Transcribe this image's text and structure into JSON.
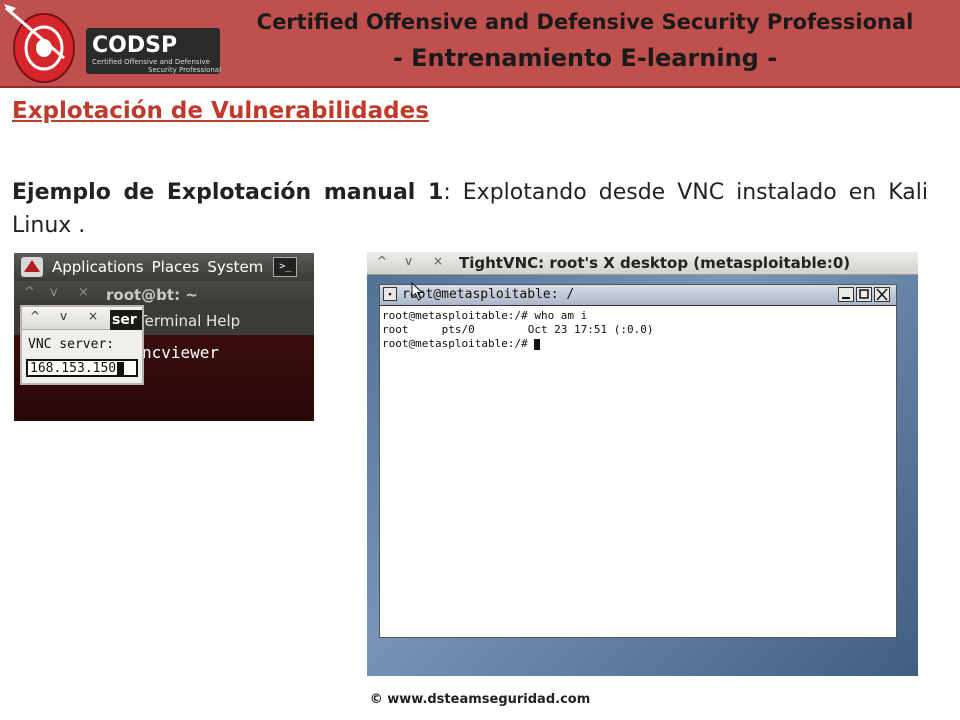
{
  "header": {
    "title": "Certified Offensive and Defensive Security Professional",
    "subtitle": "- Entrenamiento E-learning -",
    "logo": {
      "wordmark": "CODSP",
      "tagline_line1": "Certified Offensive and Defensive",
      "tagline_line2": "Security Professional"
    }
  },
  "section_title": "Explotación  de Vulnerabilidades",
  "body": {
    "bold_lead": "Ejemplo de Explotación manual 1",
    "separator": ":",
    "text": " Explotando desde VNC instalado en Kali Linux ."
  },
  "left_screenshot": {
    "panel_menus": [
      "Applications",
      "Places",
      "System"
    ],
    "terminal_title": "root@bt: ~",
    "terminal_menus": [
      "Terminal",
      "Help"
    ],
    "terminal_tab_fragment": "ser",
    "terminal_command_fragment": "ncviewer",
    "dialog": {
      "label": "VNC server:",
      "value": "168.153.150"
    },
    "titlebar_controls": [
      "^",
      "v",
      "×"
    ]
  },
  "right_screenshot": {
    "window_title": "TightVNC: root's X desktop (metasploitable:0)",
    "titlebar_controls": [
      "^",
      "v",
      "×"
    ],
    "xterm": {
      "title": "root@metasploitable: /",
      "lines": [
        "root@metasploitable:/# who am i",
        "root     pts/0        Oct 23 17:51 (:0.0)",
        "root@metasploitable:/# "
      ]
    }
  },
  "footer": "© www.dsteamseguridad.com",
  "colors": {
    "banner": "#c0504d",
    "section_title": "#c0392b",
    "desktop": "#5b7a9d"
  }
}
